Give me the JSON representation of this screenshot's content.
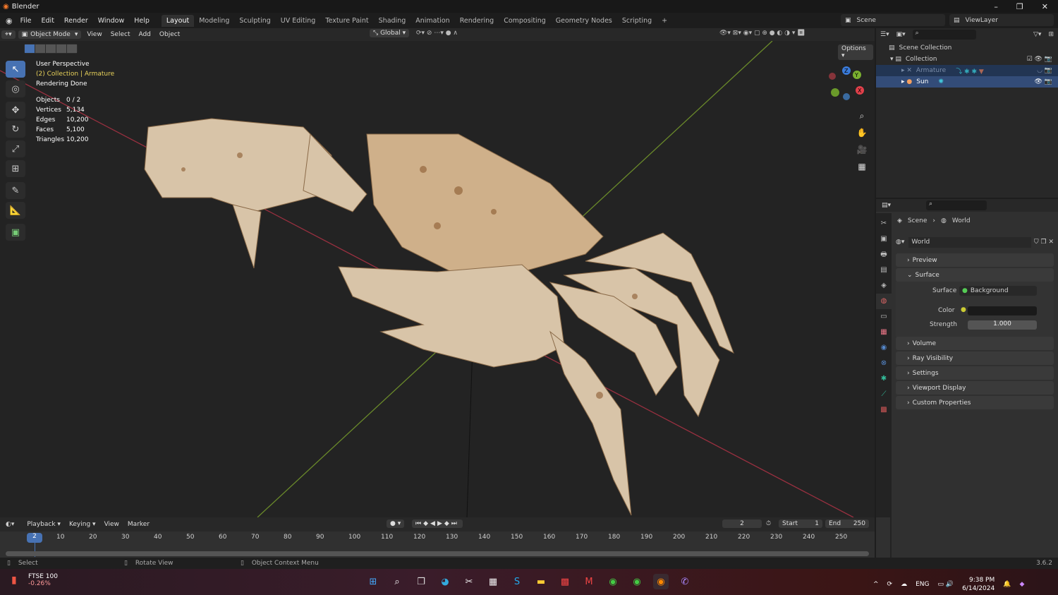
{
  "title": "Blender",
  "menu": [
    "File",
    "Edit",
    "Render",
    "Window",
    "Help"
  ],
  "workspaces": [
    "Layout",
    "Modeling",
    "Sculpting",
    "UV Editing",
    "Texture Paint",
    "Shading",
    "Animation",
    "Rendering",
    "Compositing",
    "Geometry Nodes",
    "Scripting"
  ],
  "active_workspace": "Layout",
  "scene": "Scene",
  "view_layer": "ViewLayer",
  "viewport": {
    "mode": "Object Mode",
    "menus": [
      "View",
      "Select",
      "Add",
      "Object"
    ],
    "transform": "Global",
    "options": "Options",
    "overlay": {
      "perspective": "User Perspective",
      "collection": "(2) Collection | Armature",
      "status": "Rendering Done"
    },
    "stats": [
      {
        "k": "Objects",
        "v": "0 / 2"
      },
      {
        "k": "Vertices",
        "v": "5,134"
      },
      {
        "k": "Edges",
        "v": "10,200"
      },
      {
        "k": "Faces",
        "v": "5,100"
      },
      {
        "k": "Triangles",
        "v": "10,200"
      }
    ],
    "gizmo": {
      "x": "X",
      "y": "Y",
      "z": "Z"
    }
  },
  "outliner": {
    "root": "Scene Collection",
    "collection": "Collection",
    "items": [
      "Armature",
      "Sun"
    ]
  },
  "properties": {
    "breadcrumb": [
      "Scene",
      "World"
    ],
    "world": "World",
    "panels": {
      "preview": "Preview",
      "surface": "Surface",
      "volume": "Volume",
      "ray": "Ray Visibility",
      "settings": "Settings",
      "viewport": "Viewport Display",
      "custom": "Custom Properties"
    },
    "surface_label": "Surface",
    "surface_value": "Background",
    "color_label": "Color",
    "strength_label": "Strength",
    "strength_value": "1.000"
  },
  "timeline": {
    "menus": [
      "Playback",
      "Keying",
      "View",
      "Marker"
    ],
    "current": "2",
    "start_label": "Start",
    "start": "1",
    "end_label": "End",
    "end": "250",
    "ticks": [
      "10",
      "20",
      "30",
      "40",
      "50",
      "60",
      "70",
      "80",
      "90",
      "100",
      "110",
      "120",
      "130",
      "140",
      "150",
      "160",
      "170",
      "180",
      "190",
      "200",
      "210",
      "220",
      "230",
      "240",
      "250"
    ]
  },
  "status": {
    "select": "Select",
    "rotate": "Rotate View",
    "context": "Object Context Menu",
    "version": "3.6.2"
  },
  "taskbar": {
    "stock_name": "FTSE 100",
    "stock_change": "-0.26%",
    "lang": "ENG",
    "time": "9:38 PM",
    "date": "6/14/2024"
  }
}
